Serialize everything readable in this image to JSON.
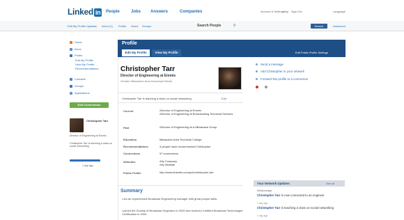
{
  "nav": {
    "logo": "Linked",
    "logo_in": "in",
    "links": [
      "People",
      "Jobs",
      "Answers",
      "Companies"
    ],
    "top_links": [
      "Account & Settings",
      "Help",
      "Sign Out",
      "Language"
    ]
  },
  "subbar": {
    "links": [
      "Edit My Profile Updates",
      "Inbox (1)",
      "Profile",
      "Home",
      "Groups"
    ],
    "search_label": "Search People",
    "search_button": "Search",
    "advanced": "Advanced"
  },
  "sidebar": {
    "items": [
      {
        "label": "Home",
        "icon": "home-icon",
        "color": "#e07b2a"
      },
      {
        "label": "Inbox",
        "icon": "inbox-icon",
        "color": "#5a8fc7"
      },
      {
        "label": "Profile",
        "icon": "profile-icon",
        "color": "#3e73a8"
      },
      {
        "label": "Edit My Profile",
        "icon": "",
        "color": ""
      },
      {
        "label": "View My Profile",
        "icon": "",
        "color": ""
      },
      {
        "label": "Recommendations",
        "icon": "",
        "color": ""
      },
      {
        "label": "Contacts",
        "icon": "contacts-icon",
        "color": "#4f86c4"
      },
      {
        "label": "Groups",
        "icon": "groups-icon",
        "color": "#3e73a8"
      },
      {
        "label": "Applications",
        "icon": "applications-icon",
        "color": "#6b96c4"
      }
    ],
    "edit_connections": "Edit Connections",
    "card": {
      "name": "Christopher Tarr",
      "line1": "Director of Engineering at Emmis",
      "line2": "Christopher Tarr is teaching a class on social networking",
      "update": "1 day ago"
    }
  },
  "profile": {
    "header_title": "Profile",
    "header_action": "Edit Public Profile Settings",
    "tabs": [
      "Edit My Profile",
      "View My Profile"
    ],
    "name": "Christopher Tarr",
    "edit": "Edit",
    "headline": "Director of Engineering at Emmis",
    "location": "Greater Milwaukee Area   Broadcast Media",
    "status": "Christopher Tarr is teaching a class on social networking",
    "status_edit": "Edit",
    "fields": [
      {
        "label": "Current",
        "values": [
          "Director of Engineering at Emmis",
          "Director of Engineering at Broadcasting Technical Services"
        ]
      },
      {
        "label": "Past",
        "values": [
          "Director of Engineering at a Milwaukee Group"
        ]
      },
      {
        "label": "Education",
        "values": [
          "Milwaukee Area Technical College"
        ]
      },
      {
        "label": "Recommendations",
        "values": [
          "3 people have recommended Christopher"
        ]
      },
      {
        "label": "Connections",
        "values": [
          "97 connections"
        ]
      },
      {
        "label": "Websites",
        "values": [
          "My Company",
          "My Website"
        ]
      },
      {
        "label": "Public Profile",
        "values": [
          "http://www.linkedin.com/pub/christopher-tarr"
        ]
      }
    ],
    "summary_title": "Summary",
    "summary_lines": [
      "I am an experienced Broadcast Engineering manager with great people skills.",
      "I joined the Society of Broadcast Engineers in 2000 and received Certified Broadcast Technologist Certification in 2004."
    ]
  },
  "right": {
    "actions": [
      "Send a message",
      "Add Christopher to your network",
      "Forward this profile to a connection"
    ],
    "network": {
      "title": "Your Network Updates",
      "more": "See all",
      "date": "Wednesday",
      "items": [
        {
          "name": "Christopher Tarr",
          "text": "is now connected to an engineer",
          "meta": "1 day ago"
        },
        {
          "name": "Christopher Tarr",
          "text": "is teaching a class on social networking",
          "meta": "1 day ago"
        }
      ]
    }
  }
}
